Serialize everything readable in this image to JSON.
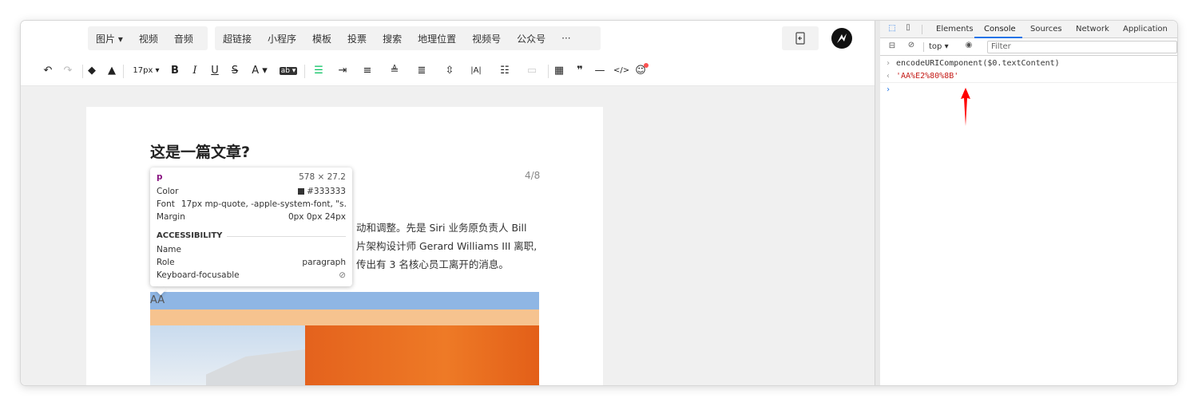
{
  "editor": {
    "top_groups": [
      {
        "items": [
          "图片 ▾",
          "视频",
          "音频"
        ]
      },
      {
        "items": [
          "超链接",
          "小程序",
          "模板",
          "投票",
          "搜索",
          "地理位置",
          "视频号",
          "公众号",
          "···"
        ]
      }
    ],
    "toolbar": {
      "font_size": "17px ▾",
      "bold": "B",
      "italic": "I",
      "underline": "U",
      "strike": "S",
      "font_color": "A ▾",
      "highlight": "ab ▾"
    },
    "article": {
      "title": "这是一篇文章?",
      "page_indicator": "4/8",
      "paragraph_lines": [
        "动和调整。先是 Siri 业务原负责人 Bill",
        "片架构设计师 Gerard Williams III 离职,",
        "传出有 3 名核心员工离开的消息。"
      ],
      "highlight_text": "AA"
    }
  },
  "inspector_tooltip": {
    "tag": "p",
    "size": "578 × 27.2",
    "color_label": "Color",
    "color_value": "#333333",
    "font_label": "Font",
    "font_value": "17px mp-quote, -apple-system-font, \"s…",
    "margin_label": "Margin",
    "margin_value": "0px 0px 24px",
    "accessibility_header": "ACCESSIBILITY",
    "name_label": "Name",
    "role_label": "Role",
    "role_value": "paragraph",
    "keyboard_label": "Keyboard-focusable"
  },
  "devtools": {
    "tabs": [
      "Elements",
      "Console",
      "Sources",
      "Network",
      "Application"
    ],
    "active_tab": "Console",
    "context": "top ▾",
    "filter_placeholder": "Filter",
    "console": {
      "input_cmd": "encodeURIComponent($0.textContent)",
      "output": "'AA%E2%80%8B'"
    }
  },
  "colors": {
    "accent": "#1a73e8",
    "string_red": "#c41a16",
    "annotation_arrow": "#ff0000",
    "highlight_blue": "#8fb6e4",
    "highlight_orange": "#f6c38f"
  }
}
